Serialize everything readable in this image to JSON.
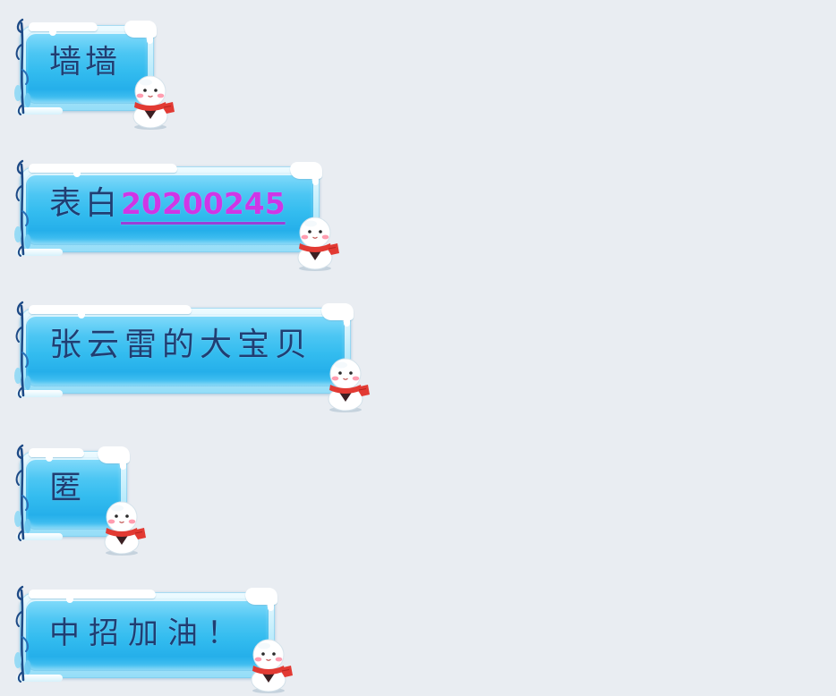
{
  "screen": {
    "background": "#e9edf2"
  },
  "theme": {
    "bubble_style": "ice-snow",
    "decoration_icon": "snowman-icon",
    "branch_icon": "ice-branch-icon",
    "colors": {
      "text": "#1f3e73",
      "link": "#cf36e6",
      "link_underline": "#9b3fd8",
      "bubble_fill": "#33bcef",
      "bubble_frame": "#c3eefc",
      "snow": "#ffffff",
      "scarf": "#e0362f"
    }
  },
  "messages": [
    {
      "text": "墙墙"
    },
    {
      "text": "表白",
      "link_text": "20200245"
    },
    {
      "text": "张云雷的大宝贝"
    },
    {
      "text": "匿"
    },
    {
      "text": "中招加油！"
    }
  ]
}
